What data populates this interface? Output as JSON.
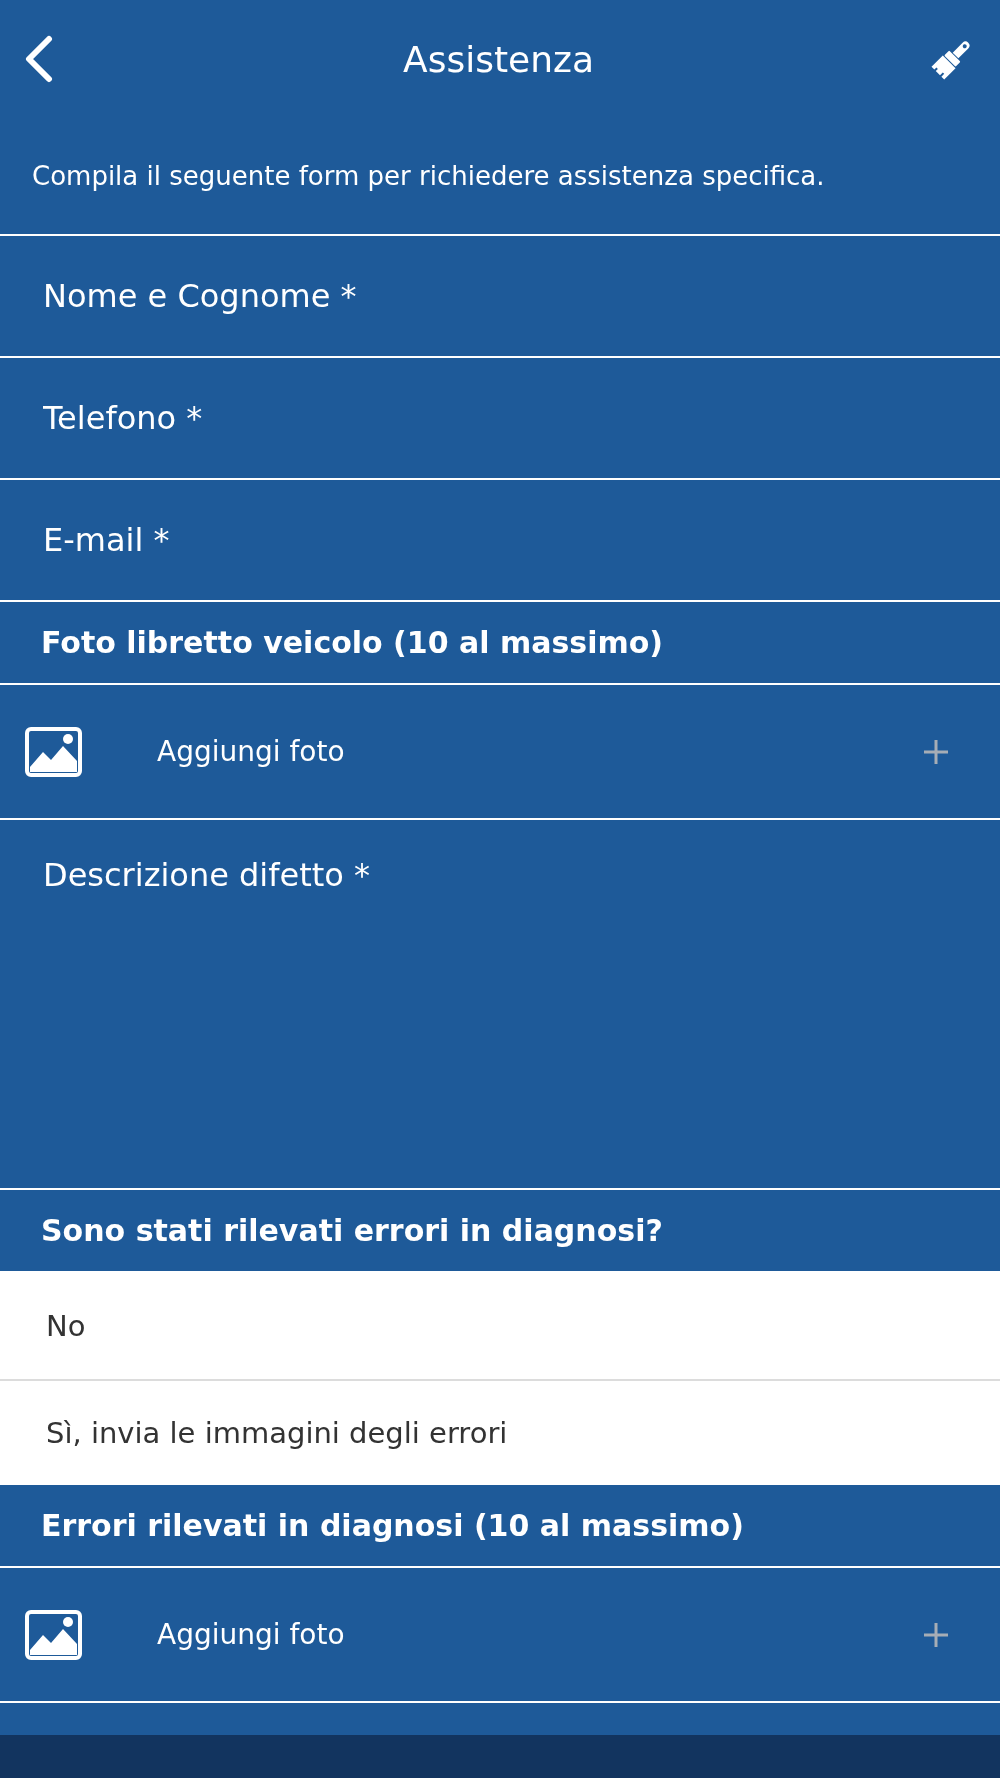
{
  "header": {
    "title": "Assistenza"
  },
  "intro": "Compila il seguente form per richiedere assistenza specifica.",
  "form": [
    {
      "kind": "input",
      "placeholder": "Nome e Cognome *"
    },
    {
      "kind": "input",
      "placeholder": "Telefono *"
    },
    {
      "kind": "input",
      "placeholder": "E-mail *"
    },
    {
      "kind": "section",
      "title": "Foto libretto veicolo (10 al massimo)"
    },
    {
      "kind": "photo",
      "label": "Aggiungi foto"
    },
    {
      "kind": "textarea",
      "placeholder": "Descrizione difetto *"
    },
    {
      "kind": "section",
      "title": "Sono stati rilevati errori in diagnosi?"
    },
    {
      "kind": "options",
      "options": [
        {
          "label": "No",
          "selected": false
        },
        {
          "label": "Sì, invia le immagini degli errori",
          "selected": false
        }
      ]
    },
    {
      "kind": "section",
      "title": "Errori rilevati in diagnosi (10 al massimo)"
    },
    {
      "kind": "photo",
      "label": "Aggiungi foto"
    }
  ]
}
